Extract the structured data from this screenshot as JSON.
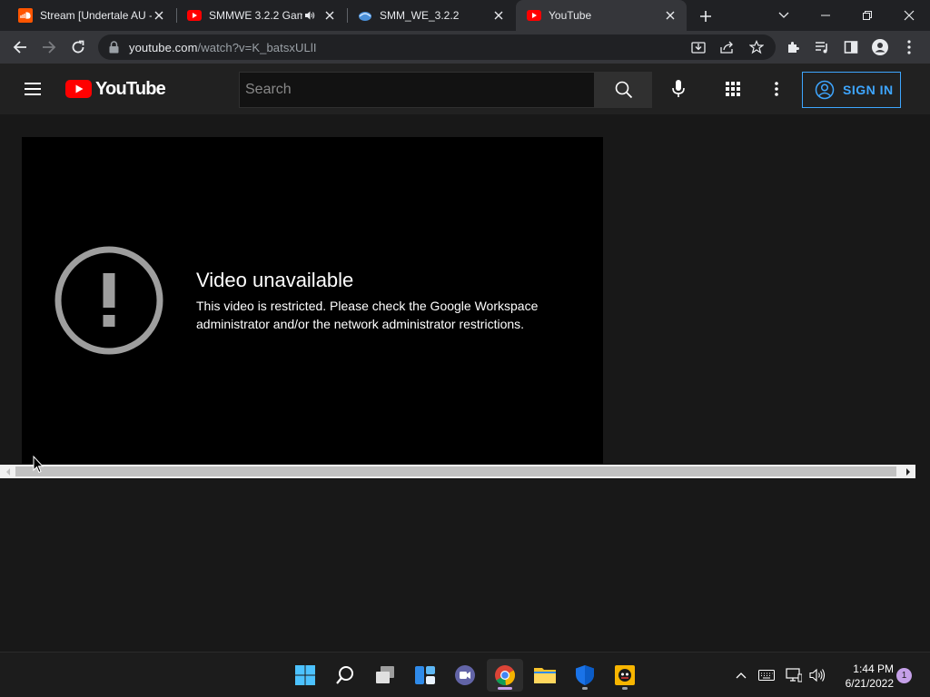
{
  "browser": {
    "tabs": [
      {
        "title": "Stream [Undertale AU -",
        "favicon": "soundcloud-icon",
        "muted_icon": false
      },
      {
        "title": "SMMWE 3.2.2 Gam",
        "favicon": "youtube-icon",
        "audio_icon": true
      },
      {
        "title": "SMM_WE_3.2.2",
        "favicon": "smm-we-icon"
      },
      {
        "title": "YouTube",
        "favicon": "youtube-icon",
        "active": true
      }
    ],
    "url_host": "youtube.com",
    "url_path": "/watch?v=K_batsxULlI"
  },
  "youtube": {
    "logo_text": "YouTube",
    "search_placeholder": "Search",
    "sign_in_label": "SIGN IN"
  },
  "player": {
    "error_title": "Video unavailable",
    "error_message": "This video is restricted. Please check the Google Workspace administrator and/or the network administrator restrictions."
  },
  "taskbar": {
    "time": "1:44 PM",
    "date": "6/21/2022",
    "notification_count": "1"
  },
  "colors": {
    "yt_red": "#ff0000",
    "signin_blue": "#3ea6ff",
    "player_bg": "#000000",
    "page_bg": "#181818"
  }
}
